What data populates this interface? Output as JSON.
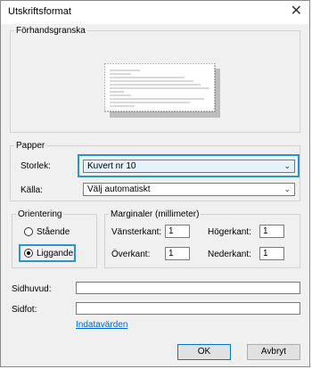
{
  "window": {
    "title": "Utskriftsformat",
    "close_glyph": "✕"
  },
  "preview": {
    "legend": "Förhandsgranska"
  },
  "paper": {
    "legend": "Papper",
    "size_label": "Storlek:",
    "size_value": "Kuvert nr 10",
    "source_label": "Källa:",
    "source_value": "Välj automatiskt"
  },
  "orientation": {
    "legend": "Orientering",
    "portrait_label": "Stående",
    "landscape_label": "Liggande",
    "selected": "landscape"
  },
  "margins": {
    "legend": "Marginaler (millimeter)",
    "left_label": "Vänsterkant:",
    "left_value": "1",
    "right_label": "Högerkant:",
    "right_value": "1",
    "top_label": "Överkant:",
    "top_value": "1",
    "bottom_label": "Nederkant:",
    "bottom_value": "1"
  },
  "header_footer": {
    "header_label": "Sidhuvud:",
    "header_value": "",
    "footer_label": "Sidfot:",
    "footer_value": "",
    "input_values_link": "Indatavärden"
  },
  "buttons": {
    "ok": "OK",
    "cancel": "Avbryt"
  },
  "colors": {
    "highlight": "#2a93c7",
    "link": "#0066cc"
  }
}
